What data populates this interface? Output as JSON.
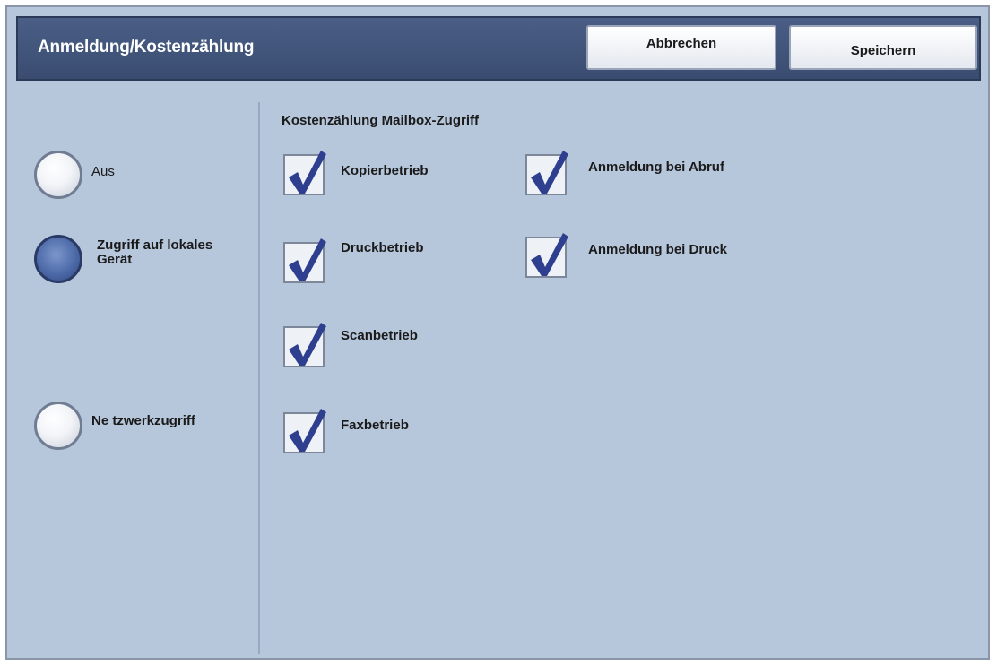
{
  "header": {
    "title": "Anmeldung/Kostenzählung",
    "cancel_label": "Abbrechen",
    "save_label": "Speichern"
  },
  "mode": {
    "options": [
      {
        "label": "Aus",
        "selected": false
      },
      {
        "label": "Zugriff auf lokales Gerät",
        "selected": true
      },
      {
        "label": "Ne tzwerkzugriff",
        "selected": false
      }
    ]
  },
  "mailbox": {
    "title": "Kostenzählung Mailbox-Zugriff",
    "items": [
      {
        "label": "Kopierbetrieb",
        "checked": true
      },
      {
        "label": "Druckbetrieb",
        "checked": true
      },
      {
        "label": "Scanbetrieb",
        "checked": true
      },
      {
        "label": "Faxbetrieb",
        "checked": true
      },
      {
        "label": "Anmeldung bei Abruf",
        "checked": true
      },
      {
        "label": "Anmeldung bei Druck",
        "checked": true
      }
    ]
  },
  "colors": {
    "panel": "#b6c6db",
    "header": "#3f527a",
    "check": "#2e3f8f"
  },
  "icons": {
    "checkmark": "checkmark-icon"
  }
}
